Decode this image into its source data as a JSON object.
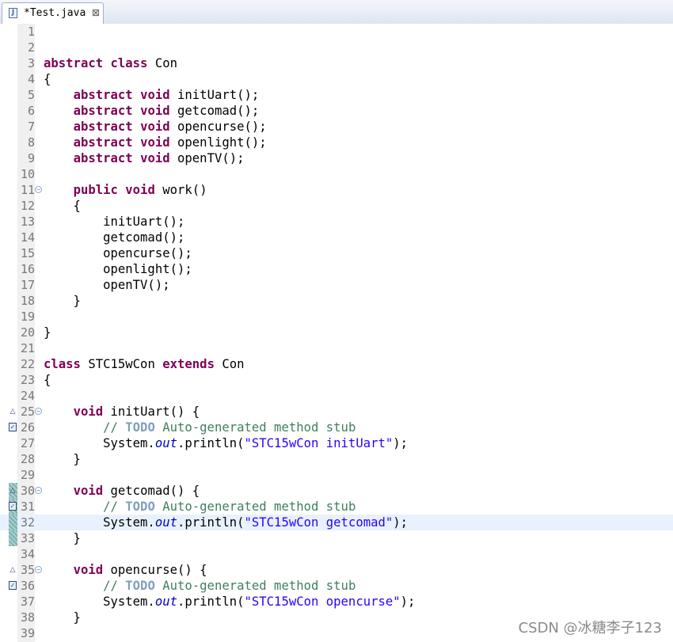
{
  "tab": {
    "title": "*Test.java",
    "close": "⊠"
  },
  "watermark": "CSDN @冰糖李子123",
  "lines": [
    {
      "n": "1",
      "html": ""
    },
    {
      "n": "2",
      "html": ""
    },
    {
      "n": "3",
      "html": "<span class=\"kw\">abstract</span> <span class=\"kw\">class</span> Con"
    },
    {
      "n": "4",
      "html": "{"
    },
    {
      "n": "5",
      "html": "    <span class=\"kw\">abstract</span> <span class=\"kw\">void</span> initUart();"
    },
    {
      "n": "6",
      "html": "    <span class=\"kw\">abstract</span> <span class=\"kw\">void</span> getcomad();"
    },
    {
      "n": "7",
      "html": "    <span class=\"kw\">abstract</span> <span class=\"kw\">void</span> opencurse();"
    },
    {
      "n": "8",
      "html": "    <span class=\"kw\">abstract</span> <span class=\"kw\">void</span> openlight();"
    },
    {
      "n": "9",
      "html": "    <span class=\"kw\">abstract</span> <span class=\"kw\">void</span> openTV();"
    },
    {
      "n": "10",
      "html": ""
    },
    {
      "n": "11",
      "fold": true,
      "html": "    <span class=\"kw\">public</span> <span class=\"kw\">void</span> work()"
    },
    {
      "n": "12",
      "html": "    {"
    },
    {
      "n": "13",
      "html": "        initUart();"
    },
    {
      "n": "14",
      "html": "        getcomad();"
    },
    {
      "n": "15",
      "html": "        opencurse();"
    },
    {
      "n": "16",
      "html": "        openlight();"
    },
    {
      "n": "17",
      "html": "        openTV();"
    },
    {
      "n": "18",
      "html": "    }"
    },
    {
      "n": "19",
      "html": ""
    },
    {
      "n": "20",
      "html": "}"
    },
    {
      "n": "21",
      "html": ""
    },
    {
      "n": "22",
      "html": "<span class=\"kw\">class</span> STC15wCon <span class=\"kw\">extends</span> Con"
    },
    {
      "n": "23",
      "html": "{"
    },
    {
      "n": "24",
      "html": ""
    },
    {
      "n": "25",
      "fold": true,
      "marker": "override",
      "html": "    <span class=\"kw\">void</span> initUart() {"
    },
    {
      "n": "26",
      "marker": "task",
      "html": "        <span class=\"cm\">// </span><span class=\"todo\">TODO</span><span class=\"cm\"> Auto-generated method stub</span>"
    },
    {
      "n": "27",
      "html": "        System.<span class=\"fld\">out</span>.println(<span class=\"str\">\"STC15wCon initUart\"</span>);"
    },
    {
      "n": "28",
      "html": "    }"
    },
    {
      "n": "29",
      "html": ""
    },
    {
      "n": "30",
      "fold": true,
      "marker": "override",
      "occ": true,
      "html": "    <span class=\"kw\">void</span> getcomad() {"
    },
    {
      "n": "31",
      "marker": "task",
      "occ": true,
      "html": "        <span class=\"cm\">// </span><span class=\"todo\">TODO</span><span class=\"cm\"> Auto-generated method stub</span>"
    },
    {
      "n": "32",
      "current": true,
      "occ": true,
      "html": "        System.<span class=\"fld\">out</span>.println(<span class=\"str\">\"STC15wCon getcomad\"</span>);"
    },
    {
      "n": "33",
      "occ": true,
      "html": "    }"
    },
    {
      "n": "34",
      "html": ""
    },
    {
      "n": "35",
      "fold": true,
      "marker": "override",
      "html": "    <span class=\"kw\">void</span> opencurse() {"
    },
    {
      "n": "36",
      "marker": "task",
      "html": "        <span class=\"cm\">// </span><span class=\"todo\">TODO</span><span class=\"cm\"> Auto-generated method stub</span>"
    },
    {
      "n": "37",
      "html": "        System.<span class=\"fld\">out</span>.println(<span class=\"str\">\"STC15wCon opencurse\"</span>);"
    },
    {
      "n": "38",
      "html": "    }"
    },
    {
      "n": "39",
      "html": ""
    }
  ]
}
